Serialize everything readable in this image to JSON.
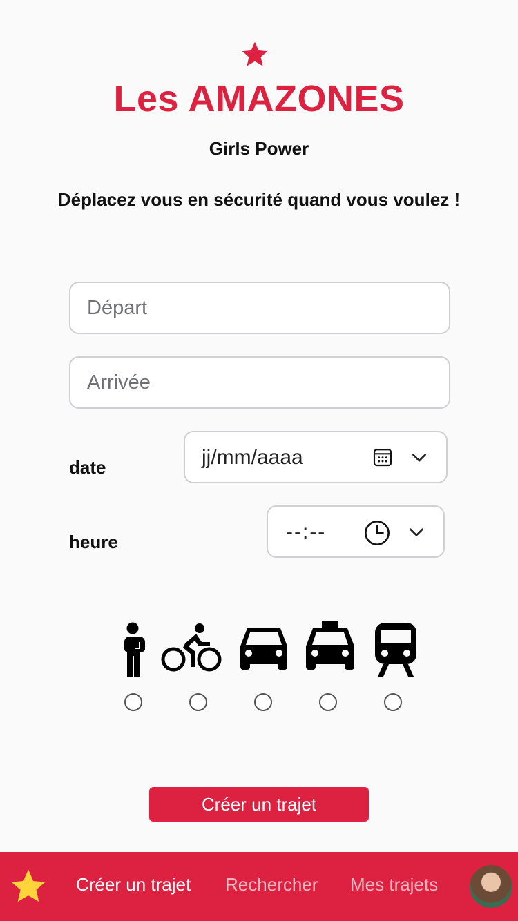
{
  "header": {
    "title": "Les AMAZONES",
    "subtitle": "Girls Power",
    "tagline": "Déplacez vous en sécurité quand vous voulez !"
  },
  "form": {
    "departure_placeholder": "Départ",
    "arrival_placeholder": "Arrivée",
    "date_label": "date",
    "date_value": "jj/mm/aaaa",
    "time_label": "heure",
    "time_value": "--:--",
    "transport_modes": [
      "walk-icon",
      "bike-icon",
      "car-icon",
      "taxi-icon",
      "train-icon"
    ],
    "submit_label": "Créer un trajet"
  },
  "nav": {
    "create": "Créer un trajet",
    "search": "Rechercher",
    "my_trips": "Mes trajets"
  },
  "colors": {
    "brand": "#dc2240",
    "nav_star": "#ffd43b"
  }
}
